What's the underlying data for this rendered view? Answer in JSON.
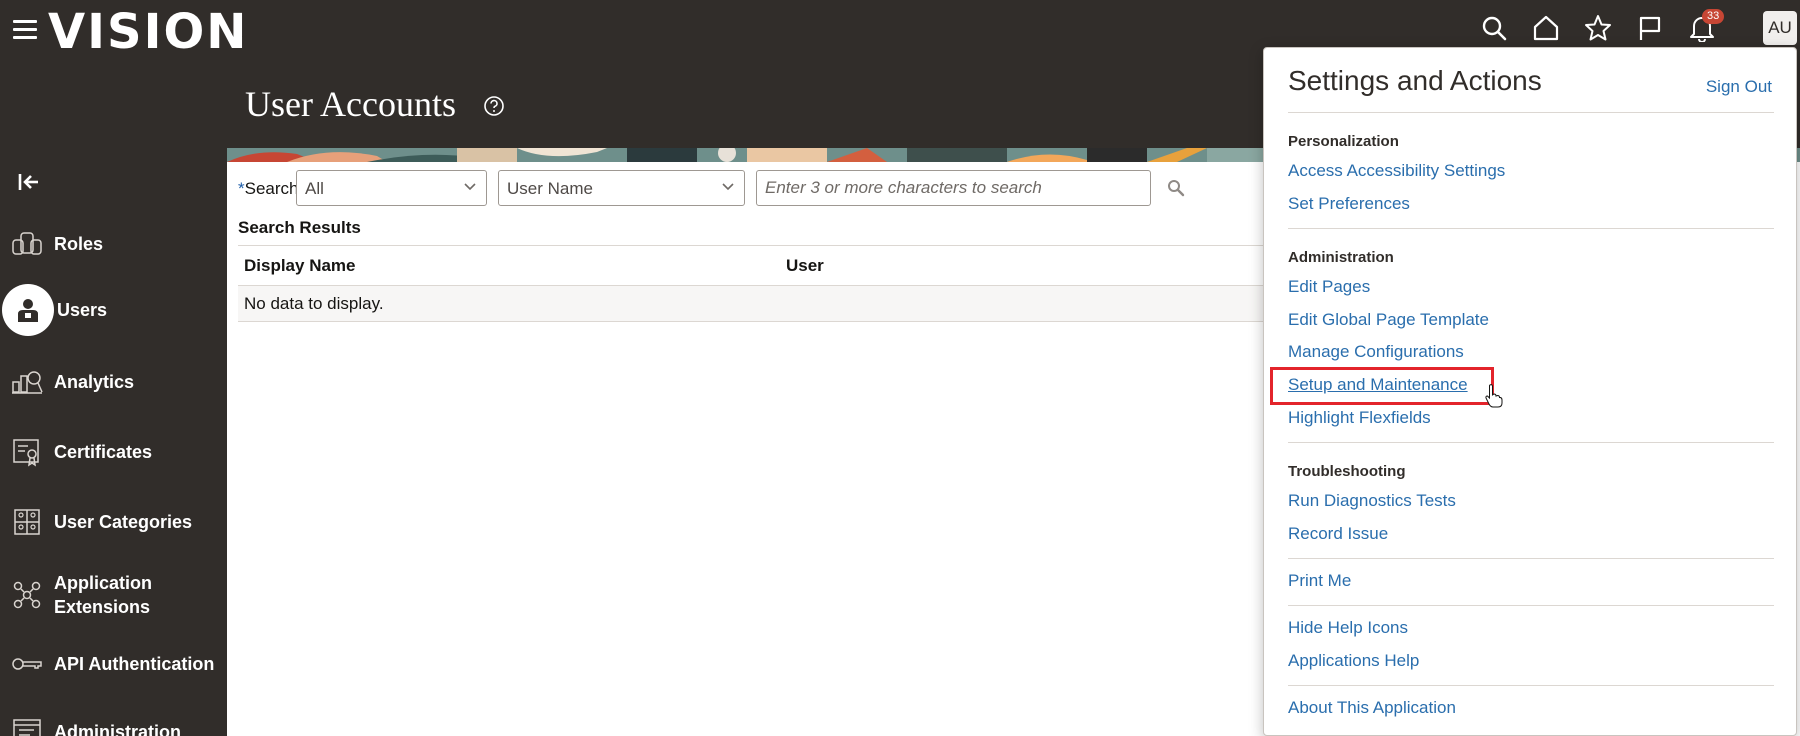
{
  "header": {
    "logo": "VISION",
    "notification_count": "33",
    "avatar_initials": "AU"
  },
  "sidebar": {
    "items": [
      {
        "label": "Roles",
        "icon": "roles-icon"
      },
      {
        "label": "Users",
        "icon": "user-icon"
      },
      {
        "label": "Analytics",
        "icon": "analytics-icon"
      },
      {
        "label": "Certificates",
        "icon": "certificate-icon"
      },
      {
        "label": "User Categories",
        "icon": "user-categories-icon"
      },
      {
        "label": "Application Extensions",
        "icon": "application-extensions-icon"
      },
      {
        "label": "API Authentication",
        "icon": "key-icon"
      },
      {
        "label": "Administration",
        "icon": "administration-icon"
      }
    ]
  },
  "main": {
    "title": "User Accounts",
    "search": {
      "label": "Search",
      "required_mark": "*",
      "filter_value": "All",
      "field_value": "User Name",
      "placeholder": "Enter 3 or more characters to search"
    },
    "results": {
      "title": "Search Results",
      "columns": [
        "Display Name",
        "User"
      ],
      "empty_text": "No data to display."
    }
  },
  "settings_panel": {
    "title": "Settings and Actions",
    "sign_out": "Sign Out",
    "sections": {
      "personalization": {
        "heading": "Personalization",
        "links": [
          "Access Accessibility Settings",
          "Set Preferences"
        ]
      },
      "administration": {
        "heading": "Administration",
        "links": [
          "Edit Pages",
          "Edit Global Page Template",
          "Manage Configurations",
          "Setup and Maintenance",
          "Highlight Flexfields"
        ]
      },
      "troubleshooting": {
        "heading": "Troubleshooting",
        "links": [
          "Run Diagnostics Tests",
          "Record Issue"
        ]
      },
      "misc": {
        "print": "Print Me",
        "help_links": [
          "Hide Help Icons",
          "Applications Help"
        ],
        "about": "About This Application"
      }
    }
  },
  "colors": {
    "header_bg": "#312d2a",
    "link": "#2a6ead",
    "badge": "#c74634",
    "highlight": "#e3242b"
  }
}
